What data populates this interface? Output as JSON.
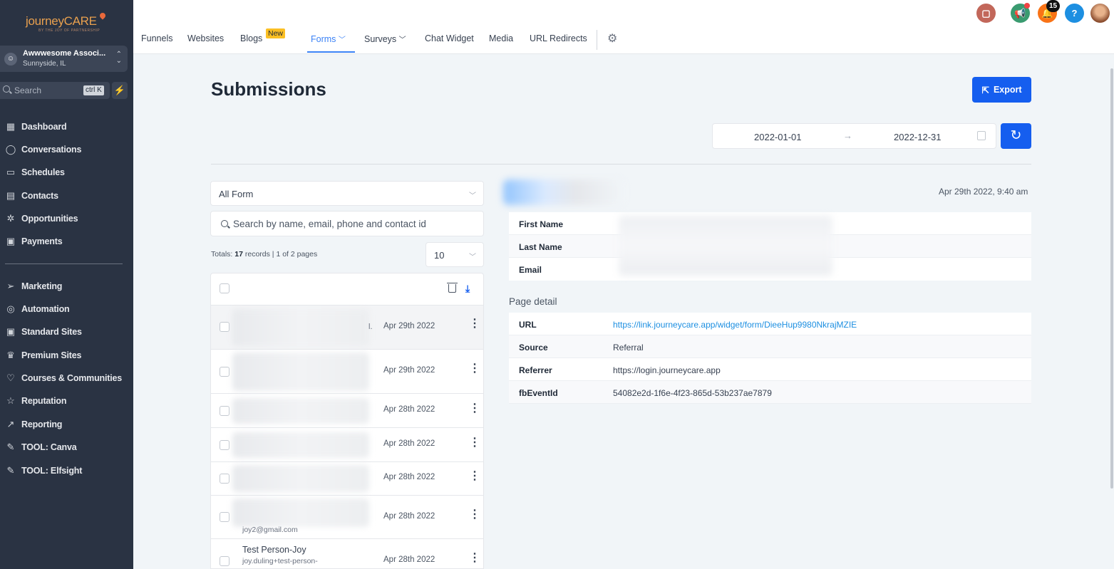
{
  "brand": {
    "logo_text": "journeyCARE",
    "logo_tagline": "BY THE JOY OF PARTNERSHIP"
  },
  "account": {
    "name": "Awwwesome Associ...",
    "location": "Sunnyside, IL"
  },
  "sidebar_search": {
    "label": "Search",
    "shortcut": "ctrl K"
  },
  "sidebar": {
    "items": [
      {
        "label": "Dashboard",
        "icon": "dashboard-icon"
      },
      {
        "label": "Conversations",
        "icon": "chat-icon"
      },
      {
        "label": "Schedules",
        "icon": "calendar-icon"
      },
      {
        "label": "Contacts",
        "icon": "contacts-icon"
      },
      {
        "label": "Opportunities",
        "icon": "opportunities-icon"
      },
      {
        "label": "Payments",
        "icon": "payments-icon"
      },
      {
        "label": "Marketing",
        "icon": "send-icon"
      },
      {
        "label": "Automation",
        "icon": "automation-icon"
      },
      {
        "label": "Standard Sites",
        "icon": "site-icon"
      },
      {
        "label": "Premium Sites",
        "icon": "premium-icon"
      },
      {
        "label": "Courses & Communities",
        "icon": "course-icon"
      },
      {
        "label": "Reputation",
        "icon": "star-icon"
      },
      {
        "label": "Reporting",
        "icon": "trend-icon"
      },
      {
        "label": "TOOL: Canva",
        "icon": "wrench-icon"
      },
      {
        "label": "TOOL: Elfsight",
        "icon": "wrench-icon"
      }
    ]
  },
  "tabs": [
    {
      "label": "Funnels"
    },
    {
      "label": "Websites"
    },
    {
      "label": "Blogs",
      "badge": "New"
    },
    {
      "label": "Forms",
      "active": true
    },
    {
      "label": "Surveys"
    },
    {
      "label": "Chat Widget"
    },
    {
      "label": "Media"
    },
    {
      "label": "URL Redirects"
    }
  ],
  "header": {
    "notification_count": "15",
    "help_label": "?"
  },
  "page": {
    "title": "Submissions",
    "export_label": "Export",
    "date_start": "2022-01-01",
    "date_end": "2022-12-31"
  },
  "filters": {
    "form_select": "All Form",
    "search_placeholder": "Search by name, email, phone and contact id",
    "totals_prefix": "Totals: ",
    "totals_count": "17",
    "totals_suffix": " records | 1 of 2 pages",
    "page_size": "10"
  },
  "submissions": [
    {
      "date": "Apr 29th 2022"
    },
    {
      "date": "Apr 29th 2022"
    },
    {
      "date": "Apr 28th 2022"
    },
    {
      "date": "Apr 28th 2022"
    },
    {
      "date": "Apr 28th 2022"
    },
    {
      "date": "Apr 28th 2022",
      "email": "joy2@gmail.com"
    },
    {
      "date": "Apr 28th 2022",
      "name": "Test Person-Joy",
      "email": "joy.duling+test-person-"
    }
  ],
  "detail": {
    "submitted_at": "Apr 29th 2022, 9:40 am",
    "fields": [
      {
        "key": "First Name"
      },
      {
        "key": "Last Name"
      },
      {
        "key": "Email"
      }
    ],
    "page_detail_label": "Page detail",
    "page_detail": [
      {
        "key": "URL",
        "value": "https://link.journeycare.app/widget/form/DieeHup9980NkrajMZIE"
      },
      {
        "key": "Source",
        "value": "Referral"
      },
      {
        "key": "Referrer",
        "value": "https://login.journeycare.app"
      },
      {
        "key": "fbEventId",
        "value": "54082e2d-1f6e-4f23-865d-53b237ae7879"
      }
    ]
  },
  "colors": {
    "sidebar_bg": "#2a3343",
    "primary": "#155eef",
    "link": "#1d8fe1",
    "badge": "#fbbf24"
  }
}
